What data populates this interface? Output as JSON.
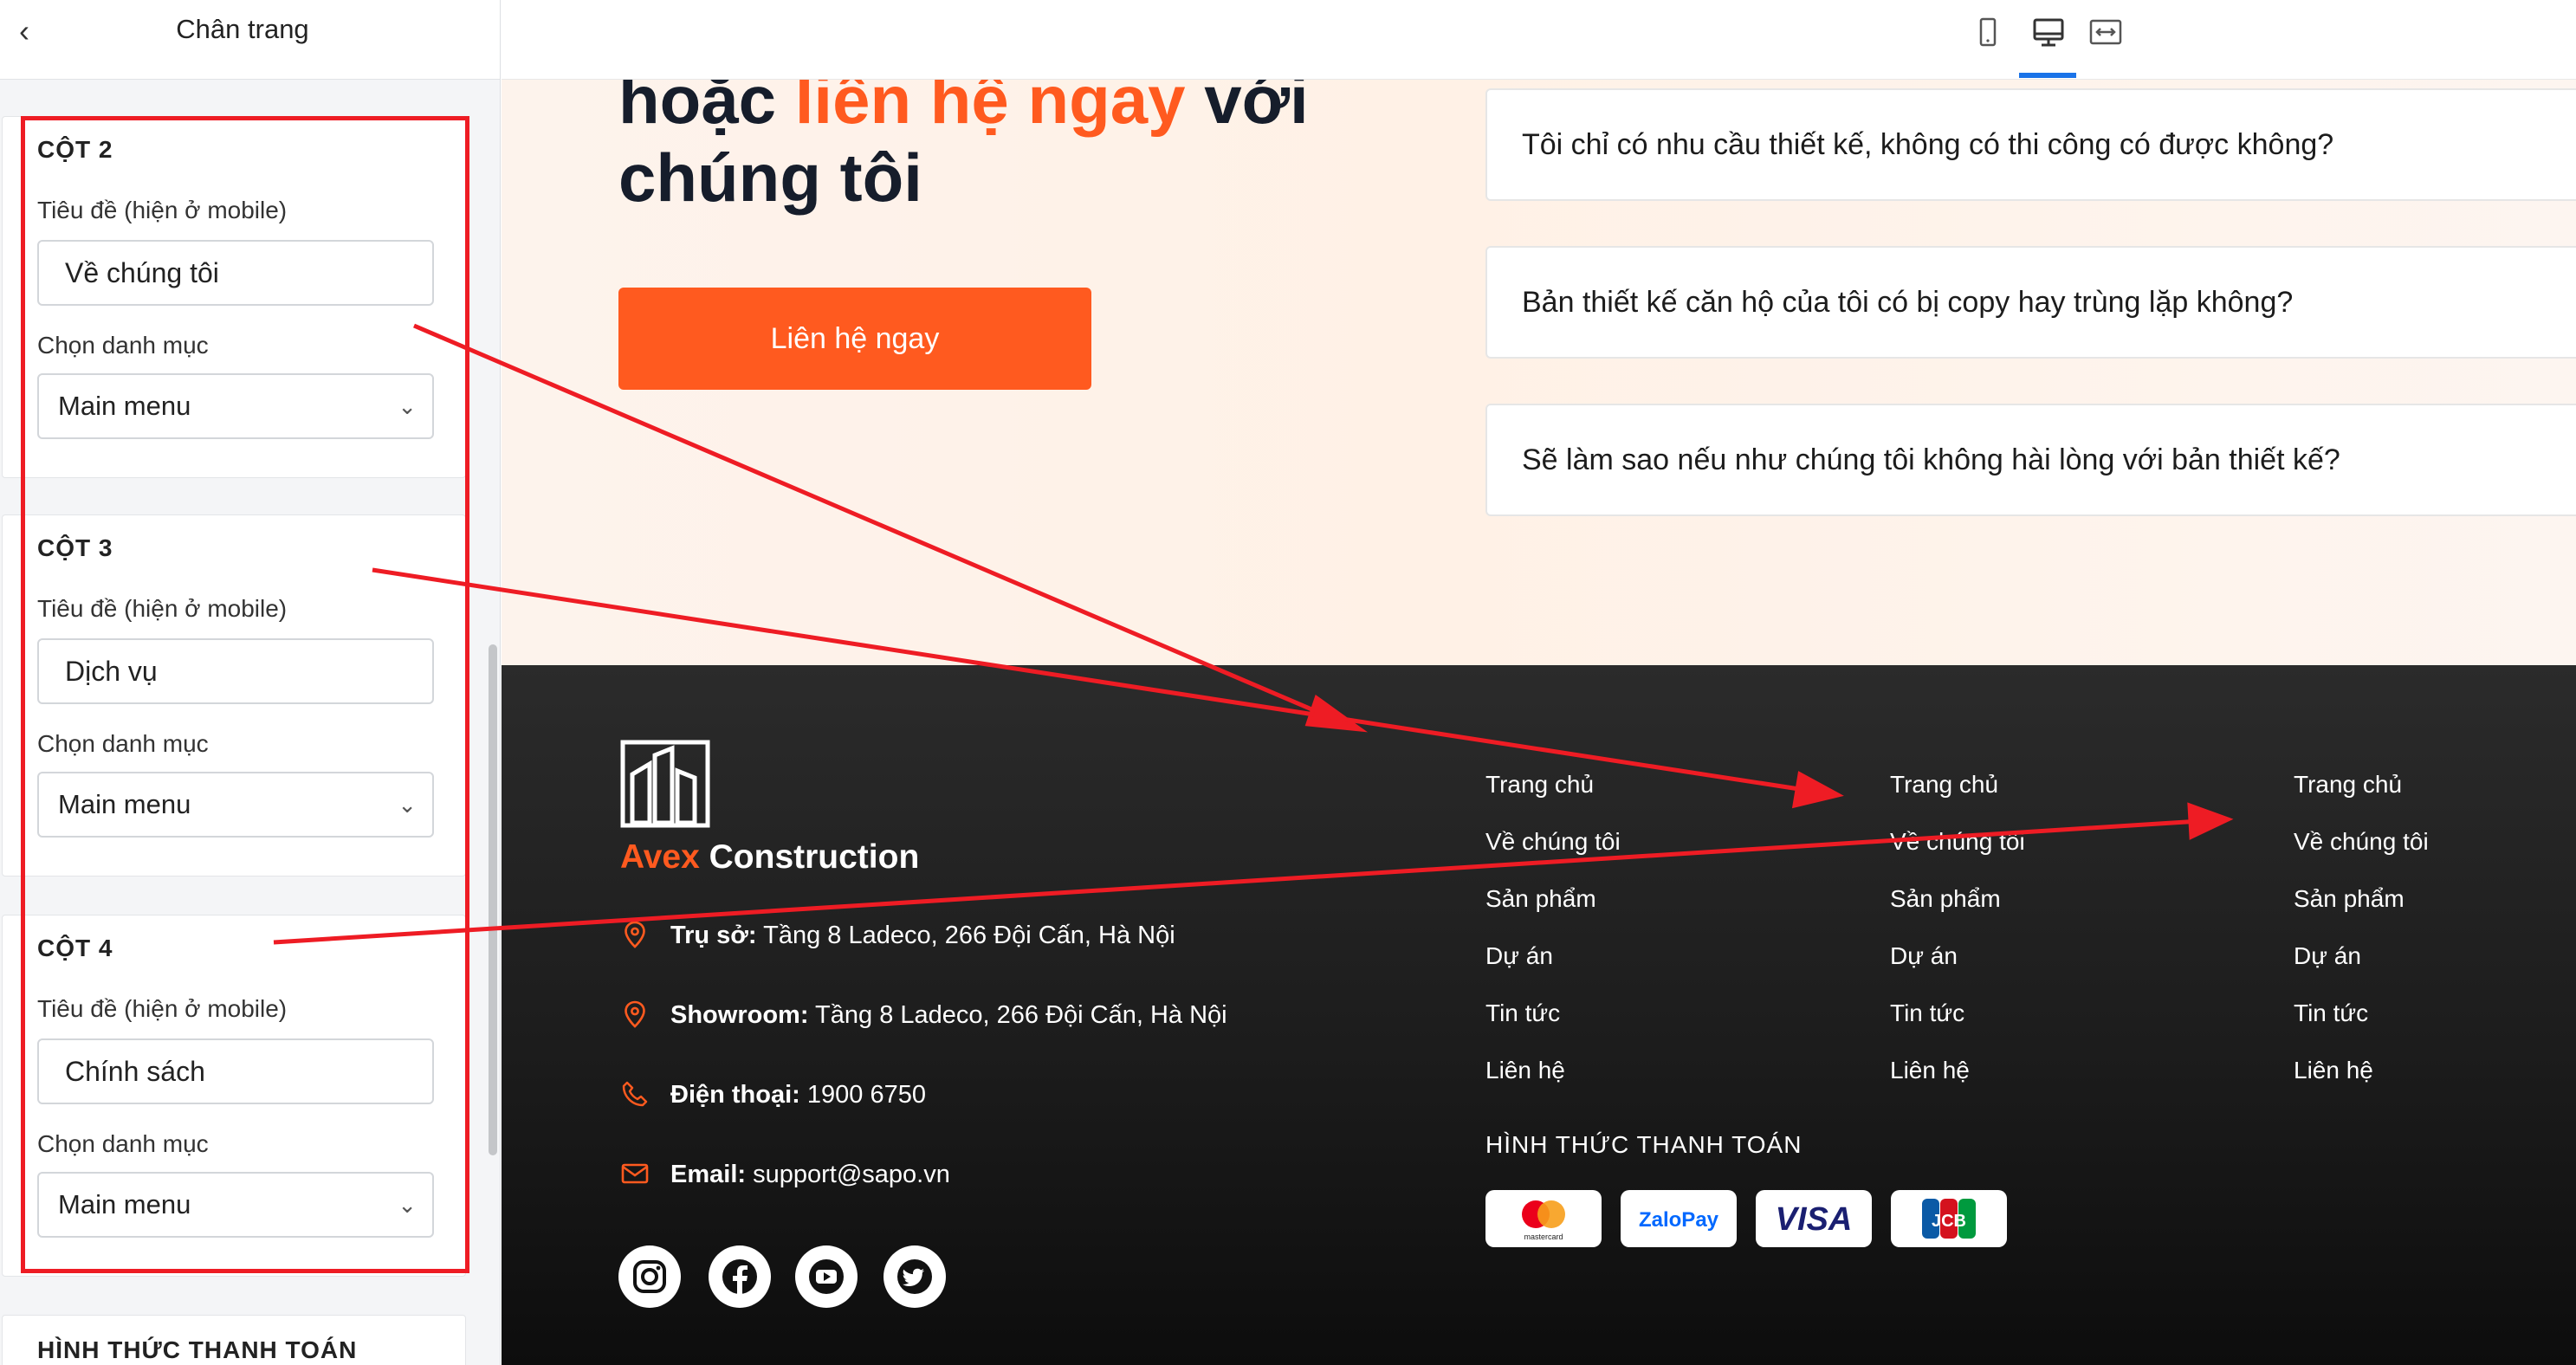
{
  "panel": {
    "title": "Chân trang",
    "back_icon": "chevron-left-icon",
    "columns": [
      {
        "title": "CỘT 2",
        "title_label": "Tiêu đề (hiện ở mobile)",
        "title_value": "Về chúng tôi",
        "menu_label": "Chọn danh mục",
        "menu_value": "Main menu"
      },
      {
        "title": "CỘT 3",
        "title_label": "Tiêu đề (hiện ở mobile)",
        "title_value": "Dịch vụ",
        "menu_label": "Chọn danh mục",
        "menu_value": "Main menu"
      },
      {
        "title": "CỘT 4",
        "title_label": "Tiêu đề (hiện ở mobile)",
        "title_value": "Chính sách",
        "menu_label": "Chọn danh mục",
        "menu_value": "Main menu"
      }
    ],
    "payment_section_title": "HÌNH THỨC THANH TOÁN"
  },
  "toolbar": {
    "icons": [
      "mobile-view-icon",
      "desktop-view-icon",
      "fullwidth-view-icon"
    ],
    "active": "desktop-view-icon",
    "active_color": "#1a73e8"
  },
  "hero": {
    "line1_prefix": "hoặc ",
    "line1_accent": "liên hệ ngay",
    "line1_suffix": " với",
    "line2": "chúng tôi",
    "cta_label": "Liên hệ ngay",
    "accent_color": "#ff5a1f"
  },
  "faq": [
    "Tôi chỉ có nhu cầu thiết kế, không có thi công có được không?",
    "Bản thiết kế căn hộ của tôi có bị copy hay trùng lặp không?",
    "Sẽ làm sao nếu như chúng tôi không hài lòng với bản thiết kế?"
  ],
  "footer": {
    "logo_accent": "Avex",
    "logo_rest": " Construction",
    "contacts": [
      {
        "icon": "map-pin-icon",
        "label": "Trụ sở:",
        "value": " Tầng 8 Ladeco, 266 Đội Cấn, Hà Nội"
      },
      {
        "icon": "map-pin-icon",
        "label": "Showroom:",
        "value": " Tầng 8 Ladeco, 266 Đội Cấn, Hà Nội"
      },
      {
        "icon": "phone-icon",
        "label": "Điện thoại:",
        "value": " 1900 6750"
      },
      {
        "icon": "mail-icon",
        "label": "Email:",
        "value": " support@sapo.vn"
      }
    ],
    "socials": [
      "instagram-icon",
      "facebook-icon",
      "youtube-icon",
      "twitter-icon"
    ],
    "menus": [
      [
        "Trang chủ",
        "Về chúng tôi",
        "Sản phẩm",
        "Dự án",
        "Tin tức",
        "Liên hệ"
      ],
      [
        "Trang chủ",
        "Về chúng tôi",
        "Sản phẩm",
        "Dự án",
        "Tin tức",
        "Liên hệ"
      ],
      [
        "Trang chủ",
        "Về chúng tôi",
        "Sản phẩm",
        "Dự án",
        "Tin tức",
        "Liên hệ"
      ]
    ],
    "payment_heading": "HÌNH THỨC THANH TOÁN",
    "payment_methods": [
      {
        "name": "mastercard",
        "label": "mastercard"
      },
      {
        "name": "zalopay",
        "label": "ZaloPay"
      },
      {
        "name": "visa",
        "label": "VISA"
      },
      {
        "name": "jcb",
        "label": "JCB"
      }
    ]
  },
  "annotation_color": "#ee1c24"
}
